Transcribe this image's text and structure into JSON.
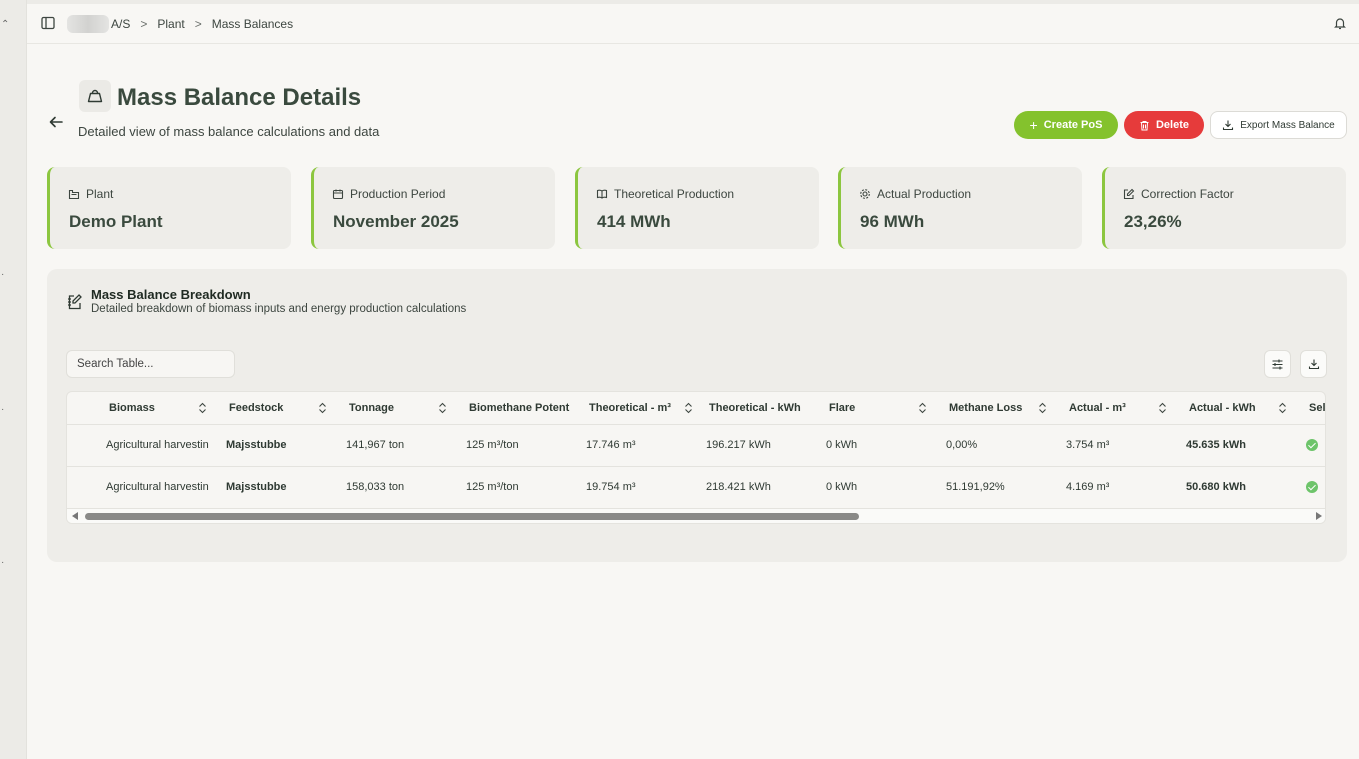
{
  "breadcrumb": {
    "org": "A/S",
    "plant": "Plant",
    "current": "Mass Balances",
    "sep": ">"
  },
  "page": {
    "title": "Mass Balance Details",
    "subtitle": "Detailed view of mass balance calculations and data"
  },
  "actions": {
    "create": "Create PoS",
    "delete": "Delete",
    "export": "Export Mass Balance"
  },
  "cards": [
    {
      "label": "Plant",
      "value": "Demo Plant",
      "icon": "building-icon"
    },
    {
      "label": "Production Period",
      "value": "November 2025",
      "icon": "calendar-icon"
    },
    {
      "label": "Theoretical Production",
      "value": "414 MWh",
      "icon": "book-icon"
    },
    {
      "label": "Actual Production",
      "value": "96 MWh",
      "icon": "gear-icon"
    },
    {
      "label": "Correction Factor",
      "value": "23,26%",
      "icon": "edit-icon"
    }
  ],
  "breakdown": {
    "title": "Mass Balance Breakdown",
    "subtitle": "Detailed breakdown of biomass inputs and energy production calculations",
    "search_placeholder": "Search Table..."
  },
  "table": {
    "columns": [
      "Biomass",
      "Feedstock",
      "Tonnage",
      "Biomethane Potent",
      "Theoretical - m³",
      "Theoretical - kWh",
      "Flare",
      "Methane Loss",
      "Actual - m³",
      "Actual - kWh",
      "Sel"
    ],
    "rows": [
      [
        "Agricultural harvestin",
        "Majsstubbe",
        "141,967 ton",
        "125 m³/ton",
        "17.746 m³",
        "196.217 kWh",
        "0 kWh",
        "0,00%",
        "3.754 m³",
        "45.635 kWh",
        "selected"
      ],
      [
        "Agricultural harvestin",
        "Majsstubbe",
        "158,033 ton",
        "125 m³/ton",
        "19.754 m³",
        "218.421 kWh",
        "0 kWh",
        "51.191,92%",
        "4.169 m³",
        "50.680 kWh",
        "selected"
      ]
    ]
  },
  "colors": {
    "accent_green": "#84c22d",
    "card_border": "#8cc63f",
    "danger": "#e63b3b",
    "check": "#6dc46a"
  }
}
